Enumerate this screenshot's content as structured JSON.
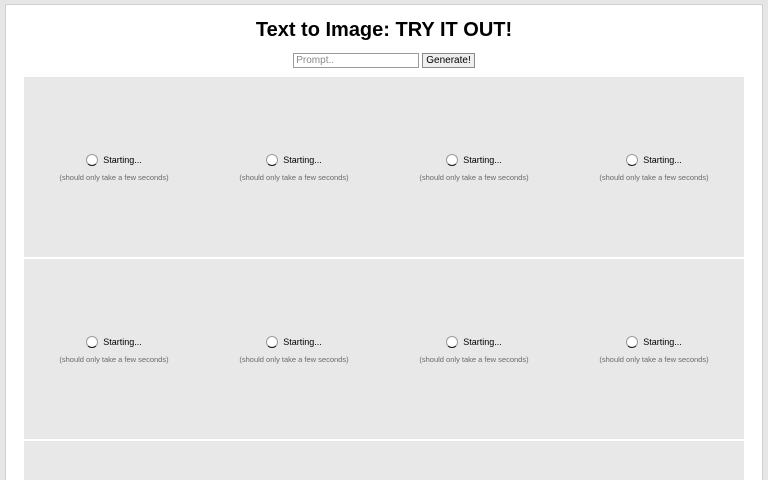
{
  "page": {
    "title": "Text to Image: TRY IT OUT!"
  },
  "prompt": {
    "placeholder": "Prompt..",
    "value": "",
    "generate_label": "Generate!"
  },
  "tiles": {
    "status_label": "Starting...",
    "hint_label": "(should only take a few seconds)",
    "rows": 2,
    "columns": 4
  },
  "icons": {
    "loading": "loading-spinner-icon"
  },
  "colors": {
    "tile_background": "#e8e8e8",
    "page_background": "#ffffff"
  }
}
